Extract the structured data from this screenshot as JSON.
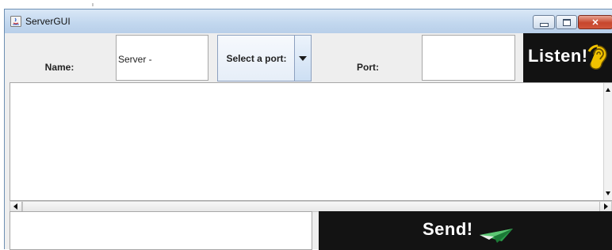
{
  "window": {
    "title": "ServerGUI",
    "title_icon": "java-app-icon",
    "controls": {
      "minimize_icon": "minimize-icon",
      "maximize_icon": "maximize-icon",
      "close_icon": "close-icon",
      "close_glyph": "✕"
    }
  },
  "top_bar": {
    "name_label": "Name:",
    "name_value": "Server -",
    "port_select": {
      "selected": "Select a port:",
      "arrow_icon": "chevron-down-icon"
    },
    "port_label": "Port:",
    "port_value": "",
    "listen_button": {
      "label": "Listen!",
      "icon": "ear-icon",
      "bg_color": "#121212",
      "icon_color": "#f2c200"
    }
  },
  "log": {
    "text": ""
  },
  "bottom_bar": {
    "message_value": "",
    "send_button": {
      "label": "Send!",
      "icon": "paper-plane-icon",
      "bg_color": "#131313",
      "icon_color": "#2a9d4a"
    }
  }
}
